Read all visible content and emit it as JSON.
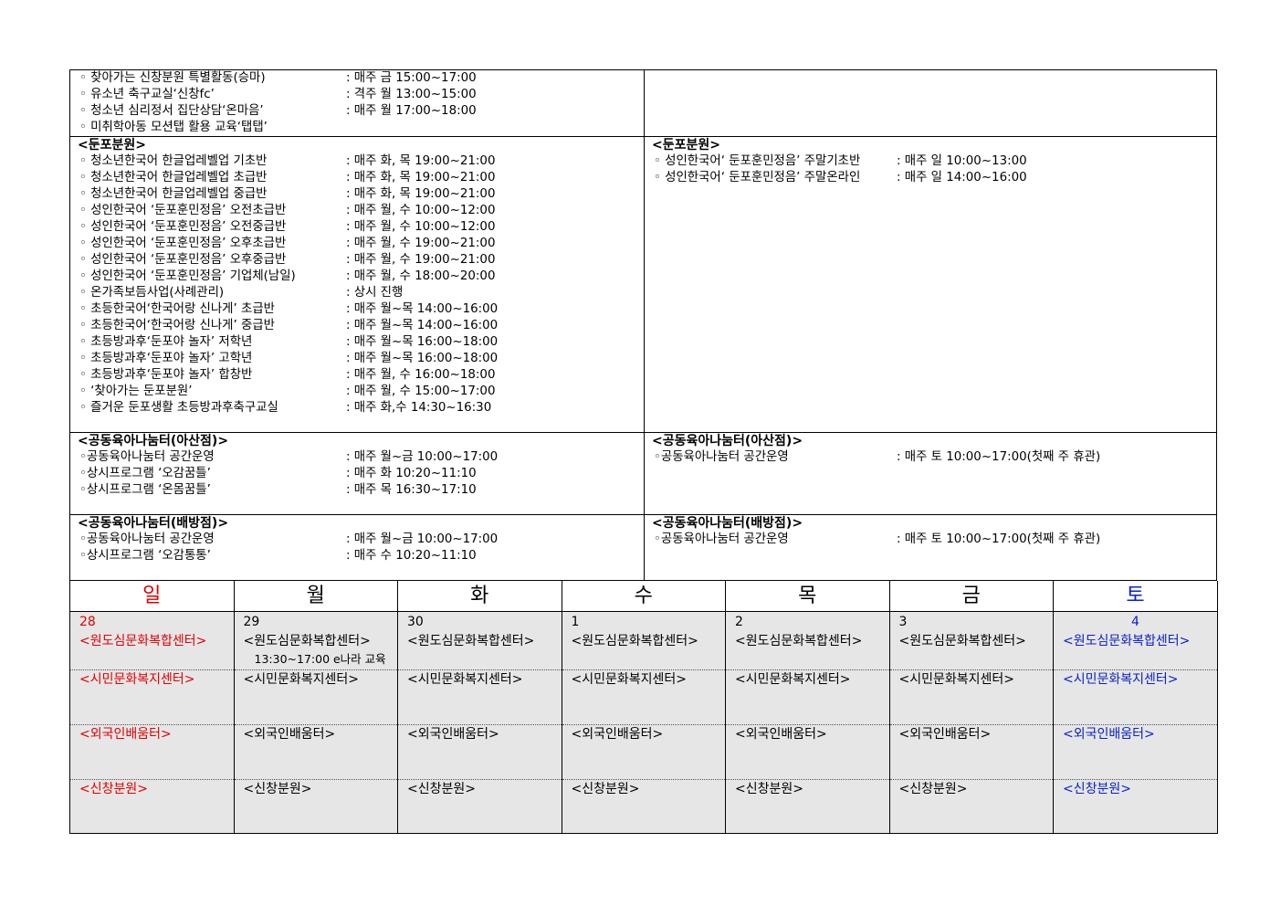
{
  "sections": [
    {
      "left": {
        "title": "",
        "items": [
          {
            "name": "◦ 찾아가는 신창분원 특별활동(승마)",
            "time": ": 매주 금 15:00~17:00"
          },
          {
            "name": "◦ 유소년 축구교실‘신창fc’",
            "time": ": 격주 월 13:00~15:00"
          },
          {
            "name": "◦ 청소년 심리정서 집단상담‘온마음’",
            "time": ": 매주 월 17:00~18:00"
          },
          {
            "name": "◦ 미취학아동 모션탭 활용 교육‘탭탭’",
            "time": ""
          }
        ]
      },
      "right": {
        "title": "",
        "items": []
      }
    },
    {
      "left": {
        "title": "<둔포분원>",
        "items": [
          {
            "name": "◦ 청소년한국어 한글업레벨업 기초반",
            "time": ": 매주 화, 목 19:00~21:00"
          },
          {
            "name": "◦ 청소년한국어 한글업레벨업 초급반",
            "time": ": 매주 화, 목 19:00~21:00"
          },
          {
            "name": "◦ 청소년한국어 한글업레벨업 중급반",
            "time": ": 매주 화, 목 19:00~21:00"
          },
          {
            "name": "◦ 성인한국어 ‘둔포훈민정음’ 오전초급반",
            "time": ": 매주 월, 수 10:00~12:00"
          },
          {
            "name": "◦ 성인한국어 ‘둔포훈민정음’ 오전중급반",
            "time": ": 매주 월, 수 10:00~12:00"
          },
          {
            "name": "◦ 성인한국어 ‘둔포훈민정음’ 오후초급반",
            "time": ": 매주 월, 수 19:00~21:00"
          },
          {
            "name": "◦ 성인한국어 ‘둔포훈민정음’ 오후중급반",
            "time": ": 매주 월, 수 19:00~21:00"
          },
          {
            "name": "◦ 성인한국어 ‘둔포훈민정음’ 기업체(남일)",
            "time": ": 매주 월, 수 18:00~20:00"
          },
          {
            "name": "◦ 온가족보듬사업(사례관리)",
            "time": ": 상시 진행"
          },
          {
            "name": "◦ 초등한국어‘한국어랑 신나게’ 초급반",
            "time": ": 매주 월~목 14:00~16:00"
          },
          {
            "name": "◦ 초등한국어‘한국어랑 신나게’ 중급반",
            "time": ": 매주 월~목 14:00~16:00"
          },
          {
            "name": "◦ 초등방과후‘둔포야 놀자’ 저학년",
            "time": ": 매주 월~목 16:00~18:00"
          },
          {
            "name": "◦ 초등방과후‘둔포야 놀자’ 고학년",
            "time": ": 매주 월~목 16:00~18:00"
          },
          {
            "name": "◦ 초등방과후‘둔포야 놀자’ 합창반",
            "time": ": 매주 월, 수 16:00~18:00"
          },
          {
            "name": "◦ ‘찾아가는 둔포분원’",
            "time": ": 매주 월, 수 15:00~17:00"
          },
          {
            "name": "◦ 즐거운 둔포생활 초등방과후축구교실",
            "time": ": 매주 화,수 14:30~16:30"
          }
        ]
      },
      "right": {
        "title": "<둔포분원>",
        "items": [
          {
            "name": "◦ 성인한국어‘ 둔포훈민정음’ 주말기초반",
            "time": ": 매주 일 10:00~13:00"
          },
          {
            "name": "◦ 성인한국어‘ 둔포훈민정음’ 주말온라인",
            "time": ": 매주 일 14:00~16:00"
          }
        ]
      }
    },
    {
      "left": {
        "title": "<공동육아나눔터(아산점)>",
        "items": [
          {
            "name": "◦공동육아나눔터 공간운영",
            "time": ": 매주 월~금 10:00~17:00"
          },
          {
            "name": "◦상시프로그램 ‘오감꿈틀’",
            "time": ": 매주 화 10:20~11:10"
          },
          {
            "name": "◦상시프로그램 ‘온몸꿈틀’",
            "time": ": 매주 목 16:30~17:10"
          }
        ]
      },
      "right": {
        "title": "<공동육아나눔터(아산점)>",
        "items": [
          {
            "name": "◦공동육아나눔터 공간운영",
            "time": ": 매주 토 10:00~17:00(첫째 주 휴관)"
          }
        ]
      }
    },
    {
      "left": {
        "title": "<공동육아나눔터(배방점)>",
        "items": [
          {
            "name": "◦공동육아나눔터 공간운영",
            "time": ": 매주 월~금 10:00~17:00"
          },
          {
            "name": "◦상시프로그램 ‘오감통통’",
            "time": ": 매주 수 10:20~11:10"
          }
        ]
      },
      "right": {
        "title": "<공동육아나눔터(배방점)>",
        "items": [
          {
            "name": "◦공동육아나눔터 공간운영",
            "time": ": 매주 토 10:00~17:00(첫째 주 휴관)"
          }
        ]
      }
    }
  ],
  "calendar": {
    "days": [
      "일",
      "월",
      "화",
      "수",
      "목",
      "금",
      "토"
    ],
    "dates": [
      "28",
      "29",
      "30",
      "1",
      "2",
      "3",
      "4"
    ],
    "rows": [
      {
        "label": "<원도심문화복합센터>",
        "extra": [
          "",
          "13:30~17:00 e나라 교육",
          "",
          "",
          "",
          "",
          ""
        ]
      },
      {
        "label": "<시민문화복지센터>",
        "extra": [
          "",
          "",
          "",
          "",
          "",
          "",
          ""
        ]
      },
      {
        "label": "<외국인배움터>",
        "extra": [
          "",
          "",
          "",
          "",
          "",
          "",
          ""
        ]
      },
      {
        "label": "<신창분원>",
        "extra": [
          "",
          "",
          "",
          "",
          "",
          "",
          ""
        ]
      }
    ],
    "colors": {
      "sunday": "#e00000",
      "saturday": "#0a22c8",
      "cell_bg": "#e6e6e6"
    }
  }
}
